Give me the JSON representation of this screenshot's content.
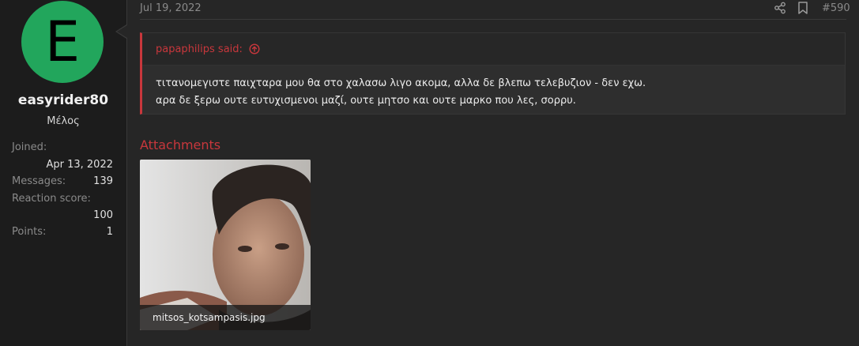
{
  "author": {
    "initial": "E",
    "username": "easyrider80",
    "title": "Μέλος",
    "avatar_color": "#22a65c",
    "stats": {
      "joined_label": "Joined:",
      "joined_value": "Apr 13, 2022",
      "messages_label": "Messages:",
      "messages_value": "139",
      "reaction_label": "Reaction score:",
      "reaction_value": "100",
      "points_label": "Points:",
      "points_value": "1"
    }
  },
  "post": {
    "date": "Jul 19, 2022",
    "number": "#590",
    "icons": [
      "share-icon",
      "bookmark-icon"
    ],
    "quote": {
      "author_said": "papaphilips said:",
      "line1": "τιτανομεγιστε παιχταρα μου θα στο χαλασω λιγο ακομα, αλλα δε βλεπω τελεβυζιον - δεν εχω.",
      "line2": "αρα δε ξερω ουτε ευτυχισμενοι μαζί, ουτε μητσο και ουτε μαρκο που λες, σορρυ."
    },
    "attachments_title": "Attachments",
    "attachment": {
      "filename": "mitsos_kotsampasis.jpg"
    }
  },
  "colors": {
    "accent": "#c8373c",
    "background": "#262626",
    "sidebar": "#1c1c1c"
  }
}
